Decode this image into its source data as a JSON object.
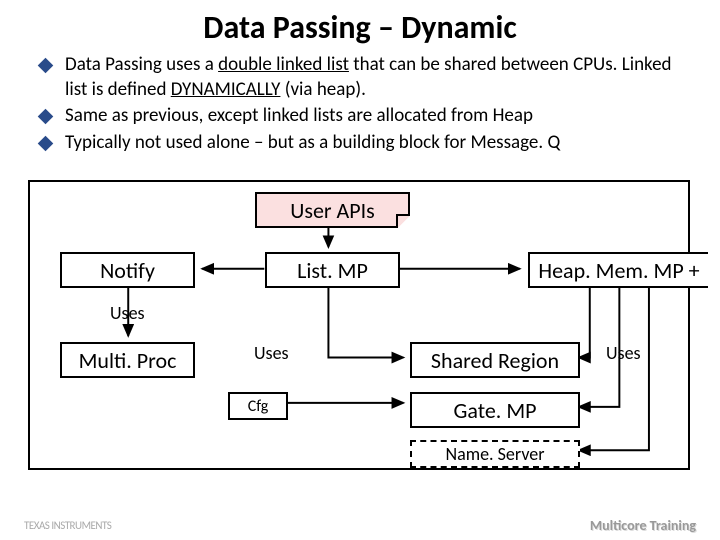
{
  "title": "Data Passing – Dynamic",
  "bullets": [
    {
      "pre": "Data Passing uses a ",
      "u1": "double linked list",
      "mid": " that can be shared between CPUs. Linked list is defined ",
      "u2": "DYNAMICALLY",
      "post": " (via heap)."
    },
    {
      "pre": "Same as previous, except linked lists are allocated from Heap",
      "u1": "",
      "mid": "",
      "u2": "",
      "post": ""
    },
    {
      "pre": "Typically not used alone – but as a building block for Message. Q",
      "u1": "",
      "mid": "",
      "u2": "",
      "post": ""
    }
  ],
  "diagram": {
    "userApis": "User APIs",
    "notify": "Notify",
    "listmp": "List. MP",
    "heapmem": "Heap. Mem. MP +",
    "multiproc": "Multi. Proc",
    "cfg": "Cfg",
    "shared": "Shared Region",
    "gatemp": "Gate. MP",
    "nameserver": "Name. Server",
    "uses": "Uses"
  },
  "footer": {
    "left": "TEXAS INSTRUMENTS",
    "right": "Multicore Training"
  }
}
